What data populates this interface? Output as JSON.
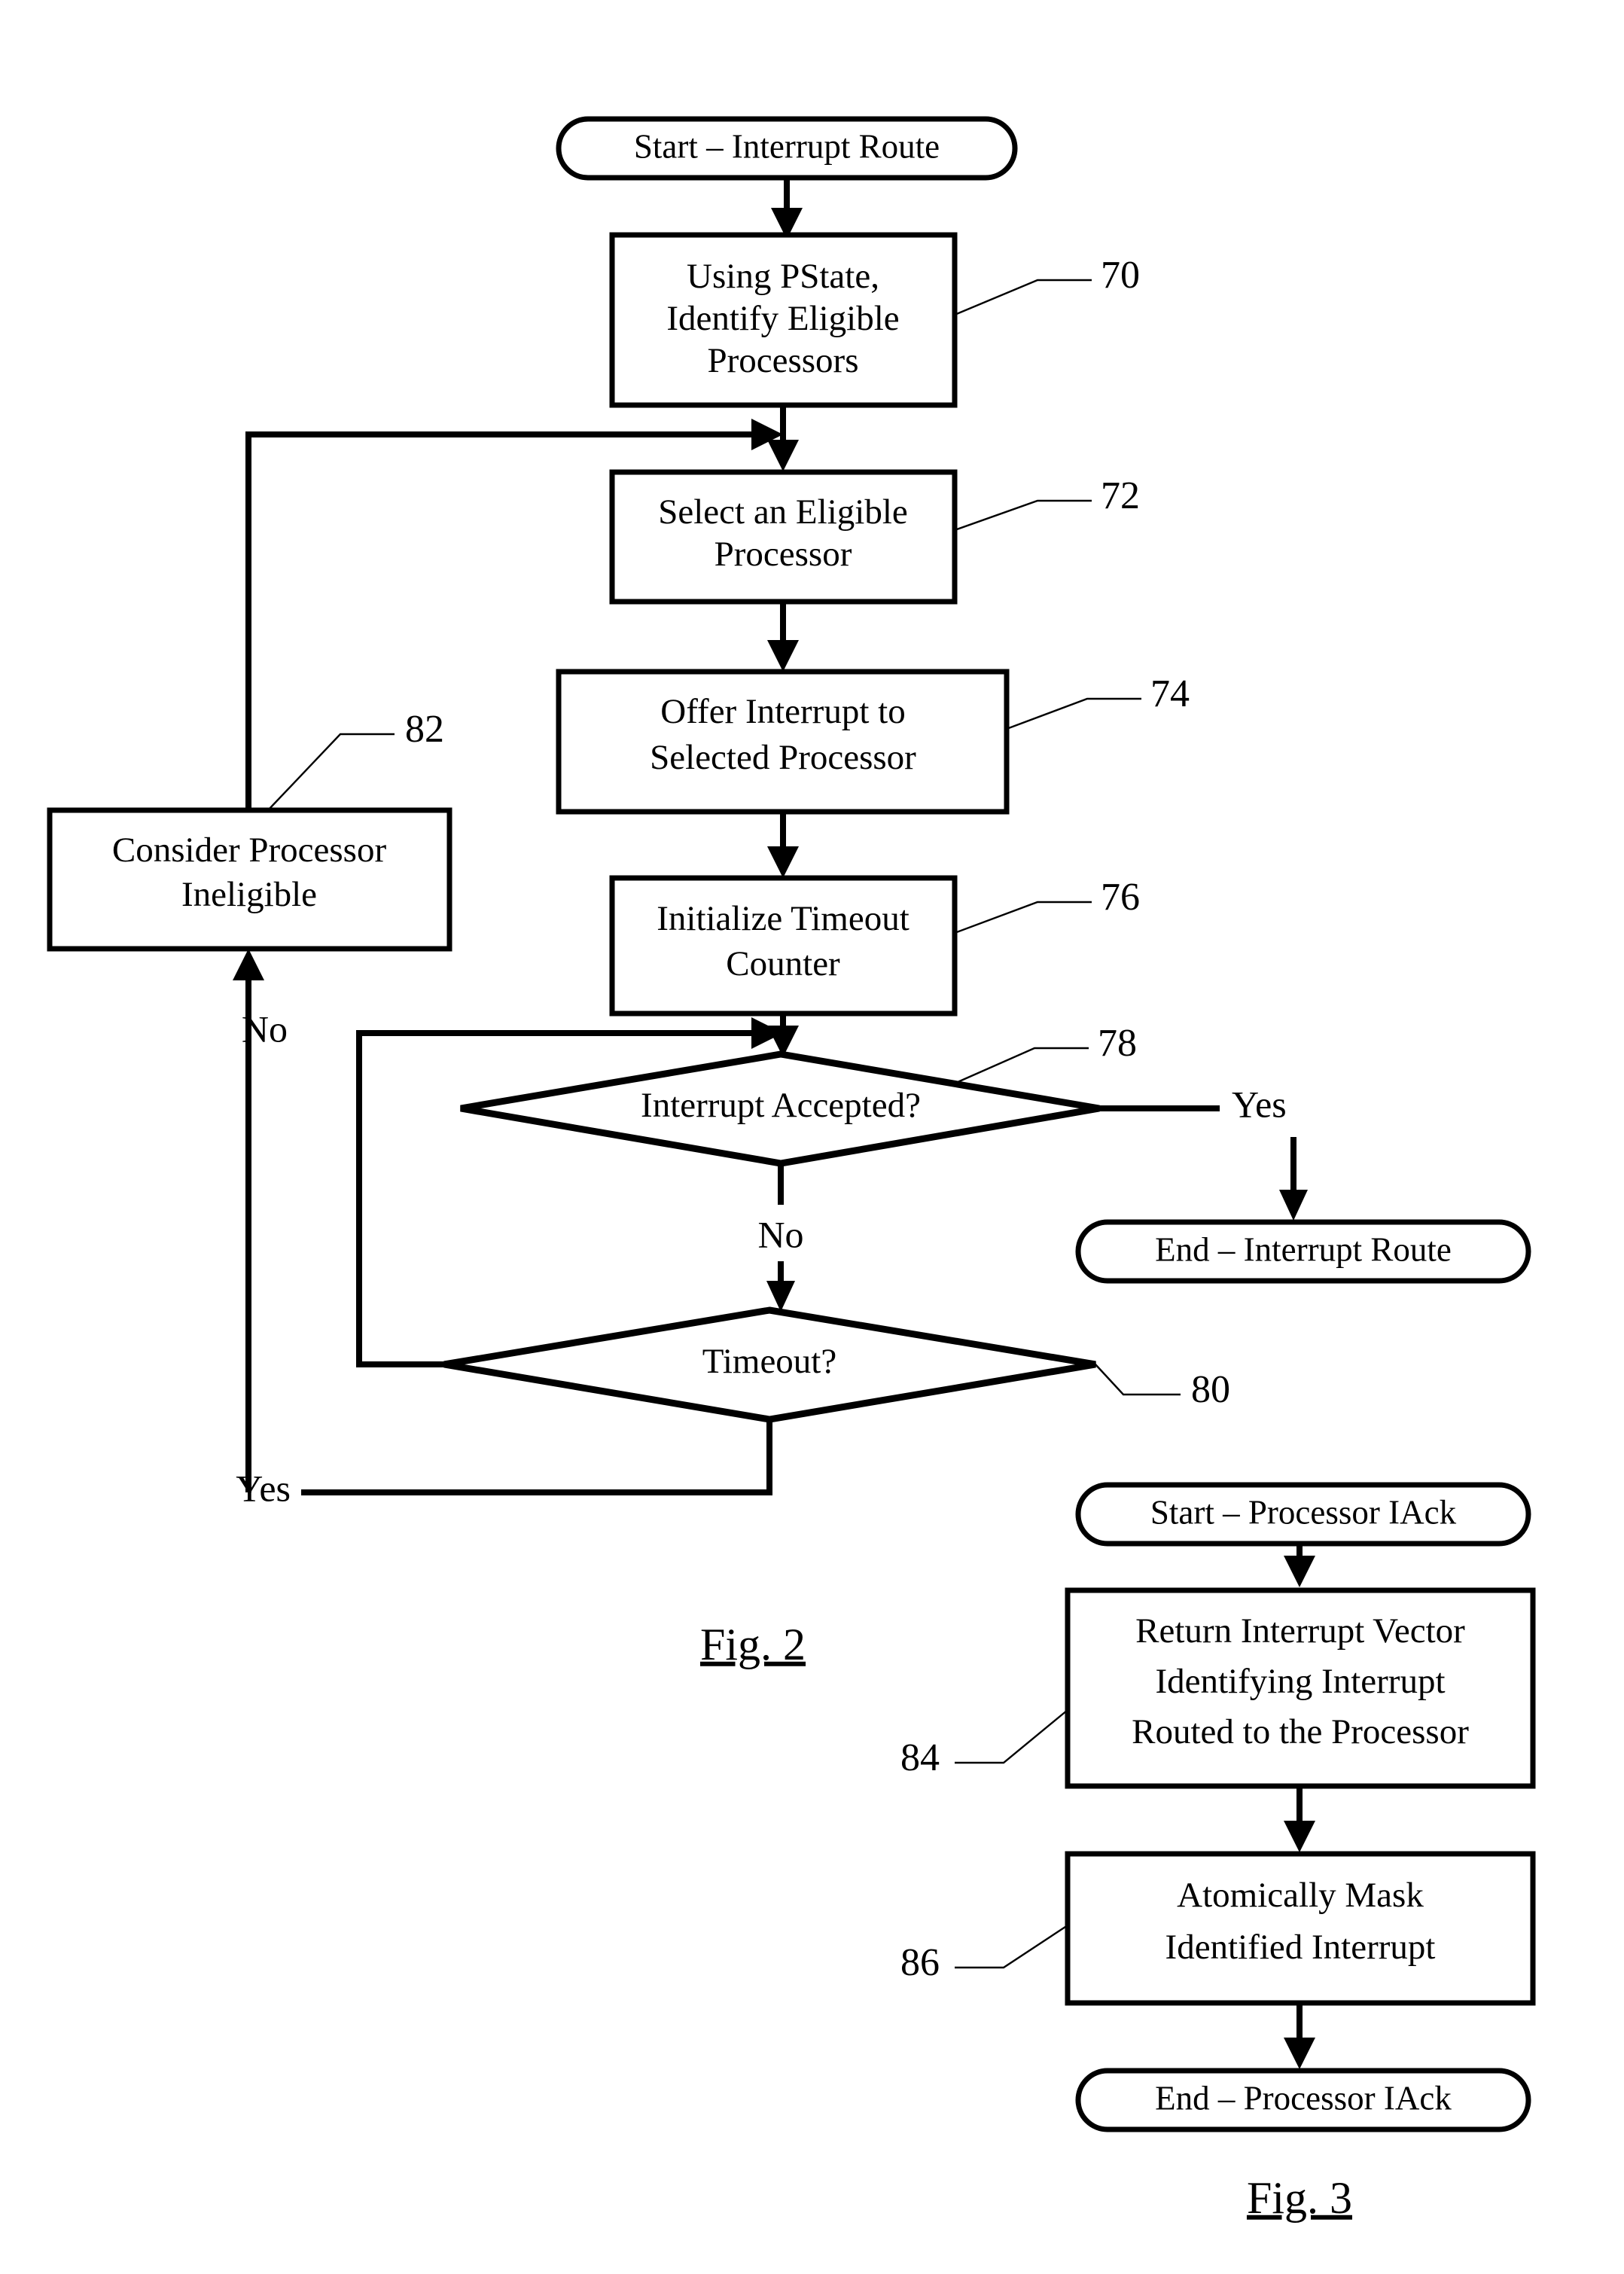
{
  "figures": [
    {
      "id": "fig-2",
      "caption": "Fig. 2",
      "nodes": {
        "start": "Start – Interrupt Route",
        "identify": "Using PState, Identify Eligible Processors",
        "identify_lines": [
          "Using PState,",
          "Identify Eligible",
          "Processors"
        ],
        "select": "Select an Eligible Processor",
        "select_lines": [
          "Select an Eligible",
          "Processor"
        ],
        "offer": "Offer Interrupt to Selected Processor",
        "offer_lines": [
          "Offer Interrupt to",
          "Selected Processor"
        ],
        "init": "Initialize Timeout Counter",
        "init_lines": [
          "Initialize Timeout",
          "Counter"
        ],
        "accepted": "Interrupt Accepted?",
        "timeout": "Timeout?",
        "ineligible": "Consider Processor Ineligible",
        "ineligible_lines": [
          "Consider Processor",
          "Ineligible"
        ],
        "end": "End – Interrupt Route"
      },
      "refs": {
        "identify": "70",
        "select": "72",
        "offer": "74",
        "init": "76",
        "accepted": "78",
        "timeout": "80",
        "ineligible": "82"
      },
      "branch_labels": {
        "accepted_yes": "Yes",
        "accepted_no_down": "No",
        "accepted_no_left": "No",
        "timeout_yes": "Yes"
      }
    },
    {
      "id": "fig-3",
      "caption": "Fig. 3",
      "nodes": {
        "start": "Start – Processor IAck",
        "return_vector": "Return Interrupt Vector Identifying Interrupt Routed to the Processor",
        "return_vector_lines": [
          "Return Interrupt Vector",
          "Identifying Interrupt",
          "Routed to the Processor"
        ],
        "mask": "Atomically Mask Identified Interrupt",
        "mask_lines": [
          "Atomically Mask",
          "Identified Interrupt"
        ],
        "end": "End – Processor IAck"
      },
      "refs": {
        "return_vector": "84",
        "mask": "86"
      }
    }
  ],
  "colors": {
    "ink": "#000000",
    "paper": "#ffffff"
  }
}
